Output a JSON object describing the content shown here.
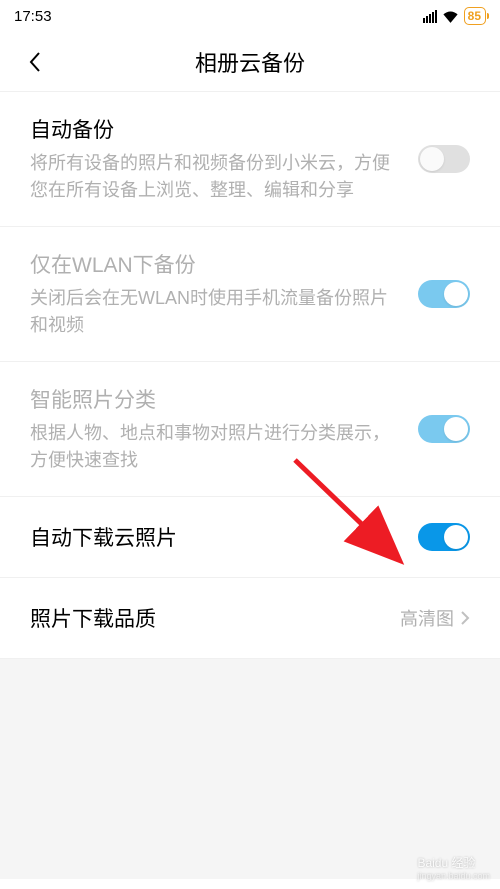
{
  "statusBar": {
    "time": "17:53",
    "battery": "85"
  },
  "header": {
    "title": "相册云备份"
  },
  "settings": {
    "autoBackup": {
      "title": "自动备份",
      "desc": "将所有设备的照片和视频备份到小米云，方便您在所有设备上浏览、整理、编辑和分享"
    },
    "wlanOnly": {
      "title": "仅在WLAN下备份",
      "desc": "关闭后会在无WLAN时使用手机流量备份照片和视频"
    },
    "smartCategory": {
      "title": "智能照片分类",
      "desc": "根据人物、地点和事物对照片进行分类展示，方便快速查找"
    },
    "autoDownload": {
      "title": "自动下载云照片"
    },
    "downloadQuality": {
      "title": "照片下载品质",
      "value": "高清图"
    }
  },
  "watermark": {
    "main": "Baidu 经验",
    "sub": "jingyan.baidu.com"
  }
}
